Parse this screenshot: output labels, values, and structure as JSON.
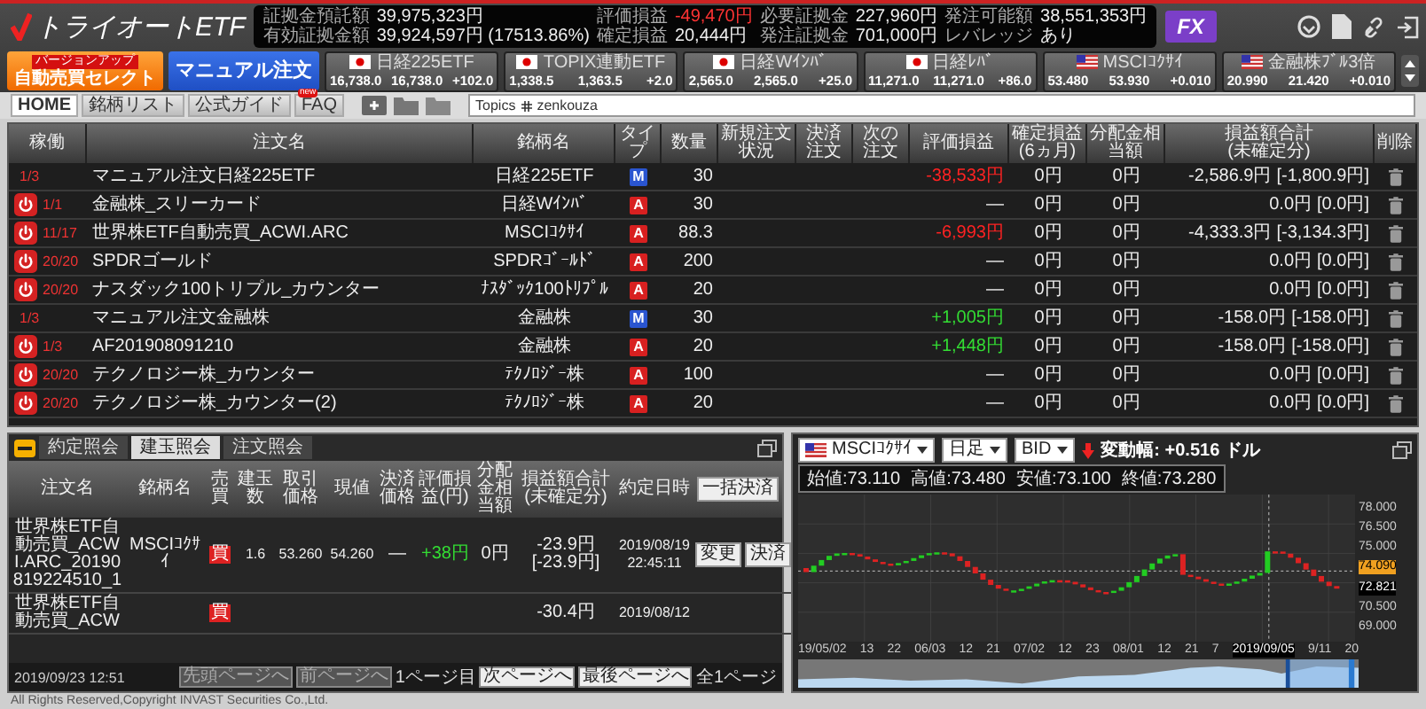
{
  "header": {
    "logo": "トライオートETF",
    "account": [
      {
        "label": "証拠金預託額",
        "value": "39,975,323円",
        "kind": "plain"
      },
      {
        "label": "評価損益",
        "value": "-49,470円",
        "kind": "loss"
      },
      {
        "label": "必要証拠金",
        "value": "227,960円",
        "kind": "plain"
      },
      {
        "label": "発注可能額",
        "value": "38,551,353円",
        "kind": "plain"
      },
      {
        "label": "有効証拠金額",
        "value": "39,924,597円 (17513.86%)",
        "kind": "plain"
      },
      {
        "label": "確定損益",
        "value": "20,444円",
        "kind": "plain"
      },
      {
        "label": "発注証拠金",
        "value": "701,000円",
        "kind": "plain"
      },
      {
        "label": "レバレッジ",
        "value": "あり",
        "kind": "plain"
      }
    ],
    "fx_button": "FX"
  },
  "actions": [
    {
      "label": "自動売買セレクト",
      "badge": "バージョンアップ",
      "kind": "orange"
    },
    {
      "label": "マニュアル注文",
      "kind": "blue"
    }
  ],
  "tickers": [
    {
      "name": "日経225ETF",
      "kind": "jp",
      "bid": "16,738.0",
      "ask": "16,738.0",
      "change": "+102.0"
    },
    {
      "name": "TOPIX連動ETF",
      "kind": "jp",
      "bid": "1,338.5",
      "ask": "1,363.5",
      "change": "+2.0"
    },
    {
      "name": "日経Wｲﾝﾊﾞ",
      "kind": "jp",
      "bid": "2,565.0",
      "ask": "2,565.0",
      "change": "+25.0"
    },
    {
      "name": "日経ﾚﾊﾞ",
      "kind": "jp",
      "bid": "11,271.0",
      "ask": "11,271.0",
      "change": "+86.0"
    },
    {
      "name": "MSCIｺｸｻｲ",
      "kind": "us",
      "bid": "53.480",
      "ask": "53.930",
      "change": "+0.010"
    },
    {
      "name": "金融株ﾌﾞﾙ3倍",
      "kind": "us",
      "bid": "20.990",
      "ask": "21.420",
      "change": "+0.010"
    }
  ],
  "nav_tabs": [
    {
      "label": "HOME",
      "selected": true
    },
    {
      "label": "銘柄リスト",
      "selected": false
    },
    {
      "label": "公式ガイド",
      "selected": false
    },
    {
      "label": "FAQ",
      "selected": false,
      "badge": "new"
    }
  ],
  "topics": {
    "label": "Topics",
    "value": "zenkouza"
  },
  "table": {
    "columns": [
      {
        "label": "稼働"
      },
      {
        "label": "注文名"
      },
      {
        "label": "銘柄名"
      },
      {
        "label": "タイプ"
      },
      {
        "label": "数量"
      },
      {
        "label": "新規注文状況"
      },
      {
        "label": "決済注文"
      },
      {
        "label": "次の注文"
      },
      {
        "label": "評価損益"
      },
      {
        "label": "確定損益",
        "sub": "(6ヵ月)"
      },
      {
        "label": "分配金相当額"
      },
      {
        "label": "損益額合計",
        "sub": "(未確定分)"
      },
      {
        "label": "削除"
      }
    ],
    "rows": [
      {
        "running": false,
        "progress": "1/3",
        "name": "マニュアル注文日経225ETF",
        "symbol": "日経225ETF",
        "type": "M",
        "qty": "30",
        "pnl": {
          "text": "-38,533円",
          "color": "#ff2222"
        },
        "realized": "0円",
        "dividend": "0円",
        "total": "-2,586.9円",
        "total_unrealized": "[-1,800.9円]"
      },
      {
        "running": true,
        "progress": "1/1",
        "name": "金融株_スリーカード",
        "symbol": "日経Wｲﾝﾊﾞ",
        "type": "A",
        "qty": "30",
        "pnl": {
          "text": "—"
        },
        "realized": "0円",
        "dividend": "0円",
        "total": "0.0円",
        "total_unrealized": "[0.0円]"
      },
      {
        "running": true,
        "progress": "11/17",
        "name": "世界株ETF自動売買_ACWI.ARC",
        "symbol": "MSCIｺｸｻｲ",
        "type": "A",
        "qty": "88.3",
        "pnl": {
          "text": "-6,993円",
          "color": "#ff2222"
        },
        "realized": "0円",
        "dividend": "0円",
        "total": "-4,333.3円",
        "total_unrealized": "[-3,134.3円]"
      },
      {
        "running": true,
        "progress": "20/20",
        "name": "SPDRゴールド",
        "symbol": "SPDRｺﾞｰﾙﾄﾞ",
        "type": "A",
        "qty": "200",
        "pnl": {
          "text": "—"
        },
        "realized": "0円",
        "dividend": "0円",
        "total": "0.0円",
        "total_unrealized": "[0.0円]"
      },
      {
        "running": true,
        "progress": "20/20",
        "name": "ナスダック100トリプル_カウンター",
        "symbol": "ﾅｽﾀﾞｯｸ100ﾄﾘﾌﾟﾙ",
        "type": "A",
        "qty": "20",
        "pnl": {
          "text": "—"
        },
        "realized": "0円",
        "dividend": "0円",
        "total": "0.0円",
        "total_unrealized": "[0.0円]"
      },
      {
        "running": false,
        "progress": "1/3",
        "name": "マニュアル注文金融株",
        "symbol": "金融株",
        "type": "M",
        "qty": "30",
        "pnl": {
          "text": "+1,005円",
          "color": "#33dd33"
        },
        "realized": "0円",
        "dividend": "0円",
        "total": "-158.0円",
        "total_unrealized": "[-158.0円]"
      },
      {
        "running": true,
        "progress": "1/3",
        "name": "AF201908091210",
        "symbol": "金融株",
        "type": "A",
        "qty": "20",
        "pnl": {
          "text": "+1,448円",
          "color": "#33dd33"
        },
        "realized": "0円",
        "dividend": "0円",
        "total": "-158.0円",
        "total_unrealized": "[-158.0円]"
      },
      {
        "running": true,
        "progress": "20/20",
        "name": "テクノロジー株_カウンター",
        "symbol": "ﾃｸﾉﾛｼﾞｰ株",
        "type": "A",
        "qty": "100",
        "pnl": {
          "text": "—"
        },
        "realized": "0円",
        "dividend": "0円",
        "total": "0.0円",
        "total_unrealized": "[0.0円]"
      },
      {
        "running": true,
        "progress": "20/20",
        "name": "テクノロジー株_カウンター(2)",
        "symbol": "ﾃｸﾉﾛｼﾞｰ株",
        "type": "A",
        "qty": "20",
        "pnl": {
          "text": "—"
        },
        "realized": "0円",
        "dividend": "0円",
        "total": "0.0円",
        "total_unrealized": "[0.0円]"
      }
    ]
  },
  "positions": {
    "tabs": [
      {
        "label": "約定照会",
        "selected": false
      },
      {
        "label": "建玉照会",
        "selected": true
      },
      {
        "label": "注文照会",
        "selected": false
      }
    ],
    "columns": [
      "注文名",
      "銘柄名",
      "売買",
      "建玉数",
      "取引価格",
      "現値",
      "決済価格",
      "評価損益(円)",
      "分配金相当額",
      "損益額合計(未確定分)",
      "約定日時"
    ],
    "bulk_button": "一括決済",
    "rows": [
      {
        "name": "世界株ETF自動売買_ACWI.ARC_20190819224510_1",
        "symbol": "MSCIｺｸｻｲ",
        "side": "買",
        "qty": "1.6",
        "price": "53.260",
        "current": "54.260",
        "settle": "—",
        "pnl": "+38円",
        "dividend": "0円",
        "total": "-23.9円",
        "total_unrealized": "[-23.9円]",
        "date": "2019/08/19",
        "time": "22:45:11",
        "buttons": [
          "変更",
          "決済"
        ]
      },
      {
        "name": "世界株ETF自動売買_ACW",
        "side": "買",
        "total": "-30.4円",
        "date": "2019/08/12"
      }
    ],
    "updated": "2019/09/23 12:51",
    "pager": [
      {
        "label": "先頭ページへ",
        "kind": "button",
        "disabled": true
      },
      {
        "label": "前ページへ",
        "kind": "button",
        "disabled": true
      },
      {
        "label": "1ページ目",
        "kind": "text"
      },
      {
        "label": "次ページへ",
        "kind": "button",
        "disabled": false
      },
      {
        "label": "最後ページへ",
        "kind": "button",
        "disabled": false
      },
      {
        "label": "全1ページ",
        "kind": "text"
      }
    ]
  },
  "chart": {
    "selects": [
      {
        "value": "MSCIｺｸｻｲ",
        "kind": "us"
      },
      {
        "value": "日足"
      },
      {
        "value": "BID"
      }
    ],
    "change": "変動幅: +0.516 ドル",
    "ohlc": [
      "始値:73.110",
      "高値:73.480",
      "安値:73.100",
      "終値:73.280"
    ],
    "y_labels": [
      {
        "label": "78.000",
        "kind": "tick"
      },
      {
        "label": "76.500",
        "kind": "tick"
      },
      {
        "label": "75.000",
        "kind": "tick"
      },
      {
        "label": "74.090",
        "kind": "last"
      },
      {
        "label": "72.821",
        "kind": "cursor"
      },
      {
        "label": "70.500",
        "kind": "tick"
      },
      {
        "label": "69.000",
        "kind": "tick"
      }
    ],
    "x_labels": [
      {
        "label": "19/05/02",
        "kind": "tick"
      },
      {
        "label": "13",
        "kind": "tick"
      },
      {
        "label": "22",
        "kind": "tick"
      },
      {
        "label": "06/03",
        "kind": "tick"
      },
      {
        "label": "12",
        "kind": "tick"
      },
      {
        "label": "21",
        "kind": "tick"
      },
      {
        "label": "07/02",
        "kind": "tick"
      },
      {
        "label": "12",
        "kind": "tick"
      },
      {
        "label": "23",
        "kind": "tick"
      },
      {
        "label": "08/01",
        "kind": "tick"
      },
      {
        "label": "12",
        "kind": "tick"
      },
      {
        "label": "21",
        "kind": "tick"
      },
      {
        "label": "7",
        "kind": "tick"
      },
      {
        "label": "2019/09/05",
        "kind": "cursor"
      },
      {
        "label": "9/11",
        "kind": "tick"
      },
      {
        "label": "20",
        "kind": "tick"
      }
    ]
  },
  "copyright": "All Rights Reserved,Copyright INVAST Securities Co.,Ltd."
}
